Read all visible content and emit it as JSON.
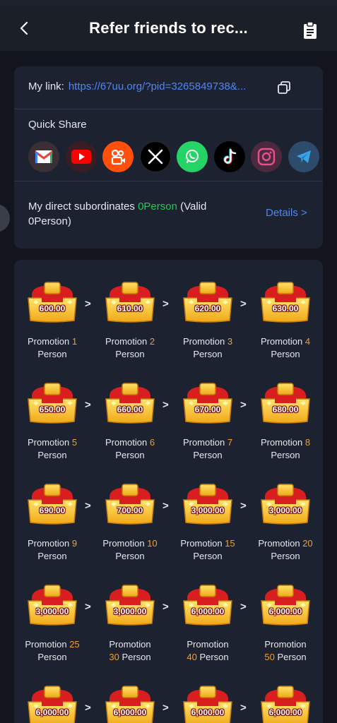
{
  "header": {
    "title": "Refer friends to rec...",
    "back_icon": "chevron-left-icon",
    "clipboard_icon": "clipboard-icon"
  },
  "link": {
    "label": "My link:",
    "url": "https://67uu.org/?pid=3265849738&..."
  },
  "quick_share": {
    "label": "Quick Share",
    "apps": [
      "gmail-icon",
      "youtube-icon",
      "kuaishou-icon",
      "x-icon",
      "whatsapp-icon",
      "tiktok-icon",
      "instagram-icon",
      "telegram-icon"
    ]
  },
  "subordinates": {
    "prefix": "My direct subordinates ",
    "count": "0Person",
    "valid": " (Valid 0Person)",
    "details": "Details >"
  },
  "rewards": [
    {
      "amount": "600.00",
      "word": "Promotion",
      "num": "1",
      "unit": "Person"
    },
    {
      "amount": "610.00",
      "word": "Promotion",
      "num": "2",
      "unit": "Person"
    },
    {
      "amount": "620.00",
      "word": "Promotion",
      "num": "3",
      "unit": "Person"
    },
    {
      "amount": "630.00",
      "word": "Promotion",
      "num": "4",
      "unit": "Person"
    },
    {
      "amount": "650.00",
      "word": "Promotion",
      "num": "5",
      "unit": "Person"
    },
    {
      "amount": "660.00",
      "word": "Promotion",
      "num": "6",
      "unit": "Person"
    },
    {
      "amount": "670.00",
      "word": "Promotion",
      "num": "7",
      "unit": "Person"
    },
    {
      "amount": "680.00",
      "word": "Promotion",
      "num": "8",
      "unit": "Person"
    },
    {
      "amount": "690.00",
      "word": "Promotion",
      "num": "9",
      "unit": "Person"
    },
    {
      "amount": "700.00",
      "word": "Promotion",
      "num": "10",
      "unit": "Person"
    },
    {
      "amount": "3,000.00",
      "word": "Promotion",
      "num": "15",
      "unit": "Person"
    },
    {
      "amount": "3,000.00",
      "word": "Promotion",
      "num": "20",
      "unit": "Person"
    },
    {
      "amount": "3,000.00",
      "word": "Promotion",
      "num": "25",
      "unit": "Person"
    },
    {
      "amount": "3,000.00",
      "word": "Promotion",
      "num": "30",
      "unit": "Person"
    },
    {
      "amount": "6,000.00",
      "word": "Promotion",
      "num": "40",
      "unit": "Person"
    },
    {
      "amount": "6,000.00",
      "word": "Promotion",
      "num": "50",
      "unit": "Person"
    },
    {
      "amount": "6,000.00"
    },
    {
      "amount": "6,000.00"
    },
    {
      "amount": "6,000.00"
    },
    {
      "amount": "6,000.00"
    }
  ],
  "arrow": ">"
}
